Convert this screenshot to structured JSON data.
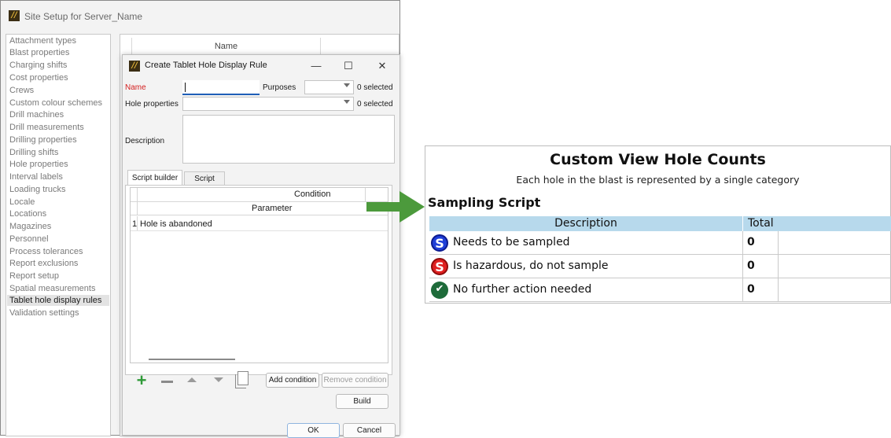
{
  "site_window": {
    "title": "Site Setup for Server_Name",
    "categories": [
      "Attachment types",
      "Blast properties",
      "Charging shifts",
      "Cost properties",
      "Crews",
      "Custom colour schemes",
      "Drill machines",
      "Drill measurements",
      "Drilling properties",
      "Drilling shifts",
      "Hole properties",
      "Interval labels",
      "Loading trucks",
      "Locale",
      "Locations",
      "Magazines",
      "Personnel",
      "Process tolerances",
      "Report exclusions",
      "Report setup",
      "Spatial measurements",
      "Tablet hole display rules",
      "Validation settings"
    ],
    "selected_category": "Tablet hole display rules",
    "rules_column_header": "Name"
  },
  "dialog": {
    "title": "Create Tablet Hole Display Rule",
    "minimize": "—",
    "maximize": "☐",
    "close": "✕",
    "name_label": "Name",
    "name_value": "",
    "purposes_label": "Purposes",
    "purposes_count": "0 selected",
    "hole_properties_label": "Hole properties",
    "hole_properties_count": "0 selected",
    "description_label": "Description",
    "description_value": "",
    "tabs": [
      "Script builder",
      "Script"
    ],
    "active_tab": "Script builder",
    "grid": {
      "condition_header": "Condition",
      "parameter_header": "Parameter",
      "rows": [
        {
          "index": "1",
          "text": "Hole is abandoned"
        }
      ]
    },
    "add_condition": "Add condition",
    "remove_condition": "Remove condition",
    "build": "Build",
    "ok": "OK",
    "cancel": "Cancel"
  },
  "custom_view": {
    "title": "Custom View Hole Counts",
    "subtitle": "Each hole in the blast is represented by a single category",
    "section": "Sampling Script",
    "headers": {
      "description": "Description",
      "total": "Total"
    },
    "rows": [
      {
        "icon": "s-blue-circle-icon",
        "icon_glyph": "S",
        "icon_color": "#1f3fd8",
        "description": "Needs to be sampled",
        "total": "0"
      },
      {
        "icon": "s-red-circle-icon",
        "icon_glyph": "S",
        "icon_color": "#e02020",
        "description": "Is hazardous, do not sample",
        "total": "0"
      },
      {
        "icon": "check-green-circle-icon",
        "icon_glyph": "✔",
        "icon_color": "#1e6b3a",
        "description": "No further action needed",
        "total": "0"
      }
    ],
    "header_color": "#b7d9ec"
  },
  "arrow_color": "#4c9a3c"
}
